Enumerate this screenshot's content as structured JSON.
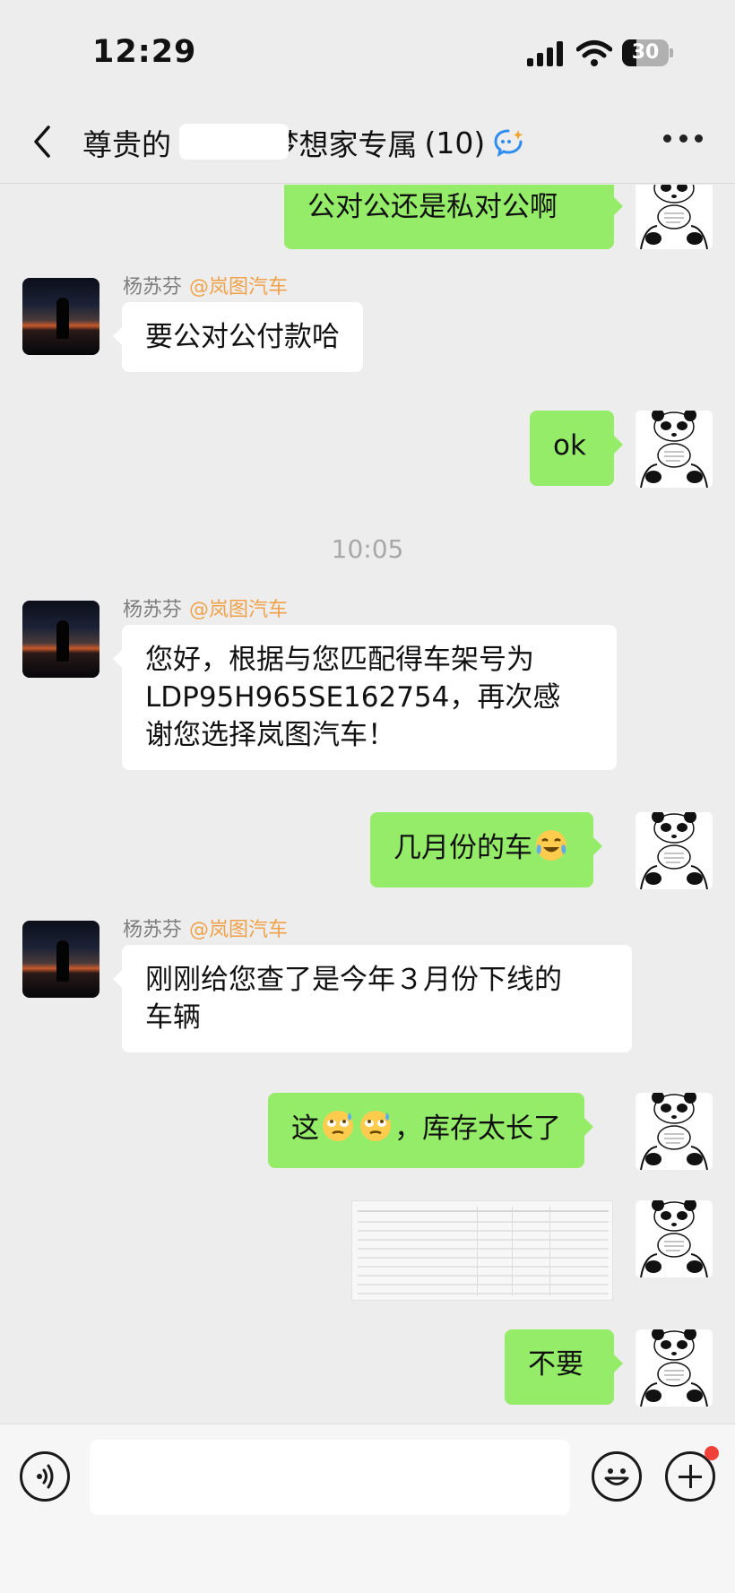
{
  "status_bar": {
    "time": "12:29",
    "battery": "30",
    "battery_level": 0.3
  },
  "nav": {
    "title": "尊贵的          先生的梦想家专属",
    "member_count": "(10)"
  },
  "messages": [
    {
      "side": "out",
      "text": "公对公还是私对公啊"
    },
    {
      "side": "in",
      "sender": "杨苏芬",
      "org": "@岚图汽车",
      "text": "要公对公付款哈"
    },
    {
      "side": "out",
      "text": "ok"
    },
    {
      "type": "time",
      "text": "10:05"
    },
    {
      "side": "in",
      "sender": "杨苏芬",
      "org": "@岚图汽车",
      "text_lines": [
        "您好，根据与您匹配得车架号为",
        "LDP95H965SE162754，再次感",
        "谢您选择岚图汽车！"
      ]
    },
    {
      "side": "out",
      "text": "几月份的车",
      "emoji": "crying-laughing-emoji"
    },
    {
      "side": "in",
      "sender": "杨苏芬",
      "org": "@岚图汽车",
      "text_lines": [
        "刚刚给您查了是今年３月份下线的",
        "车辆"
      ]
    },
    {
      "side": "out",
      "text_pre": "这",
      "emoji": "sweat-roll-eyes-emoji",
      "text_post": "，库存太长了"
    },
    {
      "side": "out",
      "type": "image",
      "image_name": "spreadsheet-image"
    },
    {
      "side": "out",
      "text": "不要"
    }
  ],
  "input": {
    "placeholder": ""
  }
}
